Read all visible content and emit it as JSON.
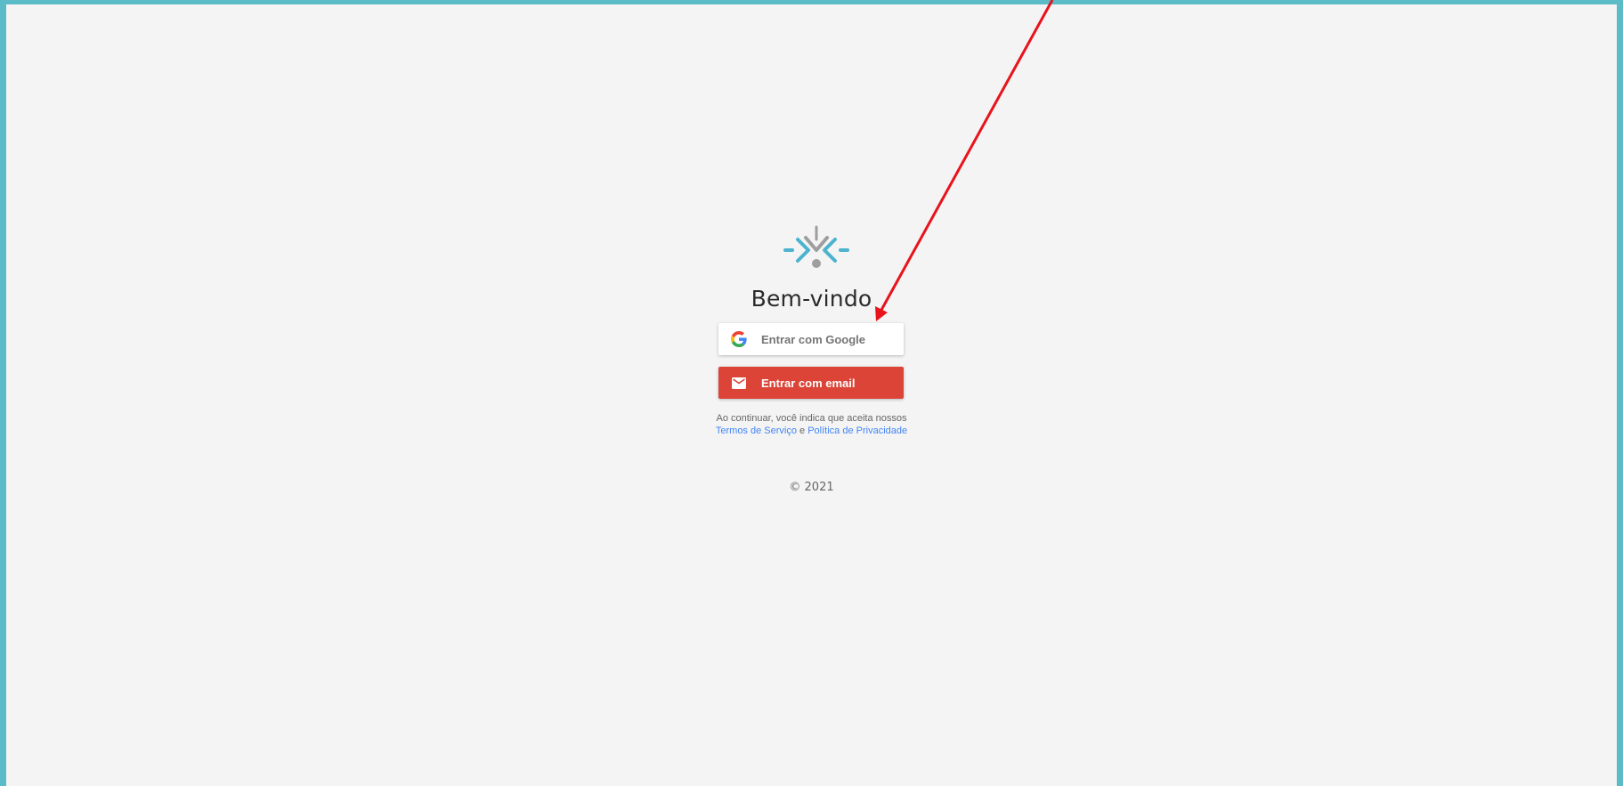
{
  "login": {
    "title": "Bem-vindo",
    "google_button": {
      "label": "Entrar com Google",
      "icon": "google-g-icon"
    },
    "email_button": {
      "label": "Entrar com email",
      "icon": "envelope-icon"
    },
    "legal": {
      "prefix": "Ao continuar, você indica que aceita nossos",
      "terms_link": "Termos de Serviço",
      "connector": "e",
      "privacy_link": "Política de Privacidade"
    },
    "copyright": "© 2021"
  },
  "colors": {
    "frame_border": "#5bbcc8",
    "background": "#f4f4f4",
    "logo_accent": "#4cb3cf",
    "logo_gray": "#9e9e9e",
    "email_button": "#db4437",
    "link": "#4285f4",
    "annotation_arrow": "#e8131b"
  }
}
